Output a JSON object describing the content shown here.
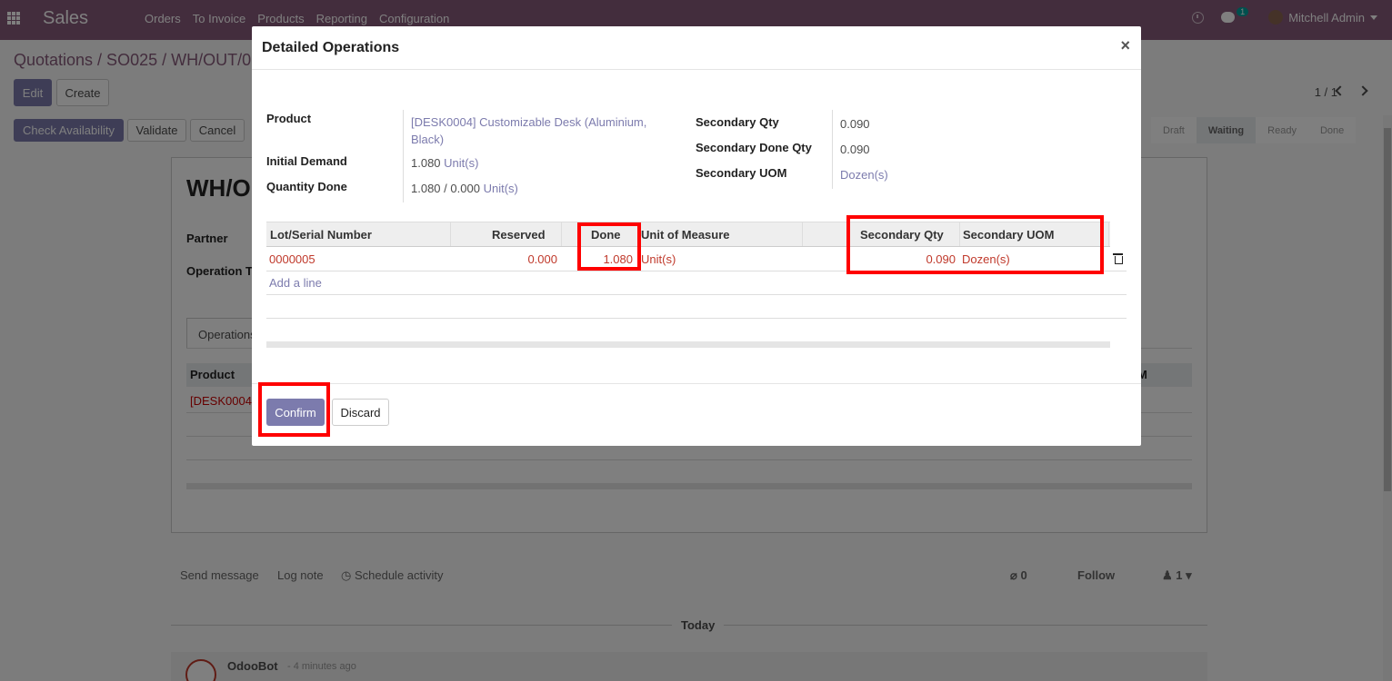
{
  "navbar": {
    "app_name": "Sales",
    "menu": [
      "Orders",
      "To Invoice",
      "Products",
      "Reporting",
      "Configuration"
    ],
    "message_count": "1",
    "user": "Mitchell Admin"
  },
  "control_panel": {
    "breadcrumb": "Quotations / SO025 / WH/OUT/0",
    "edit_label": "Edit",
    "create_label": "Create",
    "pager": "1 / 1",
    "check_availability_label": "Check Availability",
    "validate_label": "Validate",
    "cancel_label": "Cancel",
    "stages": [
      "Draft",
      "Waiting",
      "Ready",
      "Done"
    ],
    "active_stage": "Waiting"
  },
  "sheet": {
    "name": "WH/O",
    "partner_label": "Partner",
    "operation_type_label": "Operation T",
    "tab_label": "Operations",
    "product_header": "Product",
    "uom_header_fragment": "M",
    "product_cell": "[DESK0004"
  },
  "chatter": {
    "send_message": "Send message",
    "log_note": "Log note",
    "schedule_activity": "Schedule activity",
    "attachments": "0",
    "follow": "Follow",
    "followers": "1",
    "today": "Today",
    "author": "OdooBot",
    "time": "- 4 minutes ago"
  },
  "modal": {
    "title": "Detailed Operations",
    "close": "×",
    "fields": {
      "product_label": "Product",
      "product_value": "[DESK0004] Customizable Desk (Aluminium, Black)",
      "initial_demand_label": "Initial Demand",
      "initial_demand_qty": "1.080",
      "initial_demand_uom": "Unit(s)",
      "quantity_done_label": "Quantity Done",
      "quantity_done_qty": "1.080",
      "quantity_done_sep": "/",
      "quantity_done_reserved": "0.000",
      "quantity_done_uom": "Unit(s)",
      "secondary_qty_label": "Secondary Qty",
      "secondary_qty_value": "0.090",
      "secondary_done_qty_label": "Secondary Done Qty",
      "secondary_done_qty_value": "0.090",
      "secondary_uom_label": "Secondary UOM",
      "secondary_uom_value": "Dozen(s)"
    },
    "table": {
      "headers": {
        "lot": "Lot/Serial Number",
        "reserved": "Reserved",
        "done": "Done",
        "uom": "Unit of Measure",
        "secondary_qty": "Secondary Qty",
        "secondary_uom": "Secondary UOM"
      },
      "rows": [
        {
          "lot": "0000005",
          "reserved": "0.000",
          "done": "1.080",
          "uom": "Unit(s)",
          "secondary_qty": "0.090",
          "secondary_uom": "Dozen(s)"
        }
      ],
      "add_line": "Add a line"
    },
    "confirm_label": "Confirm",
    "discard_label": "Discard"
  },
  "colors": {
    "navbar": "#875a7b",
    "primary": "#7c7bad",
    "highlight": "#ff0000",
    "row_text": "#c0392b"
  }
}
